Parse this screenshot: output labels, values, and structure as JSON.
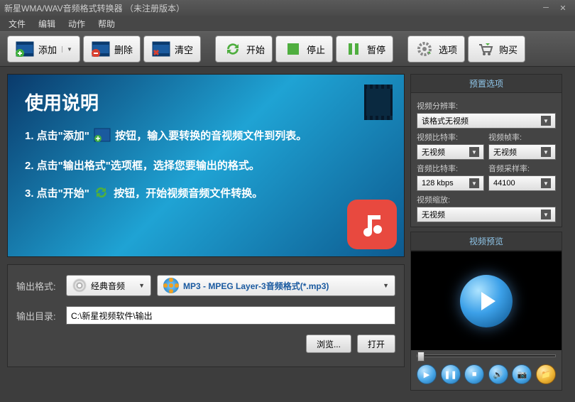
{
  "title": "新星WMA/WAV音频格式转换器  （未注册版本）",
  "menu": {
    "file": "文件",
    "edit": "编辑",
    "action": "动作",
    "help": "帮助"
  },
  "toolbar": {
    "add": "添加",
    "delete": "删除",
    "clear": "清空",
    "start": "开始",
    "stop": "停止",
    "pause": "暂停",
    "options": "选项",
    "buy": "购买"
  },
  "banner": {
    "heading": "使用说明",
    "step1a": "1. 点击\"添加\"",
    "step1b": "按钮，输入要转换的音视频文件到列表。",
    "step2": "2. 点击\"输出格式\"选项框，选择您要输出的格式。",
    "step3a": "3. 点击\"开始\"",
    "step3b": "按钮，开始视频音频文件转换。"
  },
  "output": {
    "format_label": "输出格式:",
    "category": "经典音频",
    "format": "MP3 - MPEG Layer-3音频格式(*.mp3)",
    "dir_label": "输出目录:",
    "dir_value": "C:\\新星视频软件\\输出",
    "browse": "浏览...",
    "open": "打开"
  },
  "presets": {
    "title": "预置选项",
    "video_res_label": "视频分辨率:",
    "video_res": "该格式无视频",
    "video_bitrate_label": "视频比特率:",
    "video_bitrate": "无视频",
    "video_fps_label": "视频帧率:",
    "video_fps": "无视频",
    "audio_bitrate_label": "音频比特率:",
    "audio_bitrate": "128 kbps",
    "audio_sample_label": "音频采样率:",
    "audio_sample": "44100",
    "video_zoom_label": "视频缩放:",
    "video_zoom": "无视频"
  },
  "preview": {
    "title": "视频预览"
  }
}
